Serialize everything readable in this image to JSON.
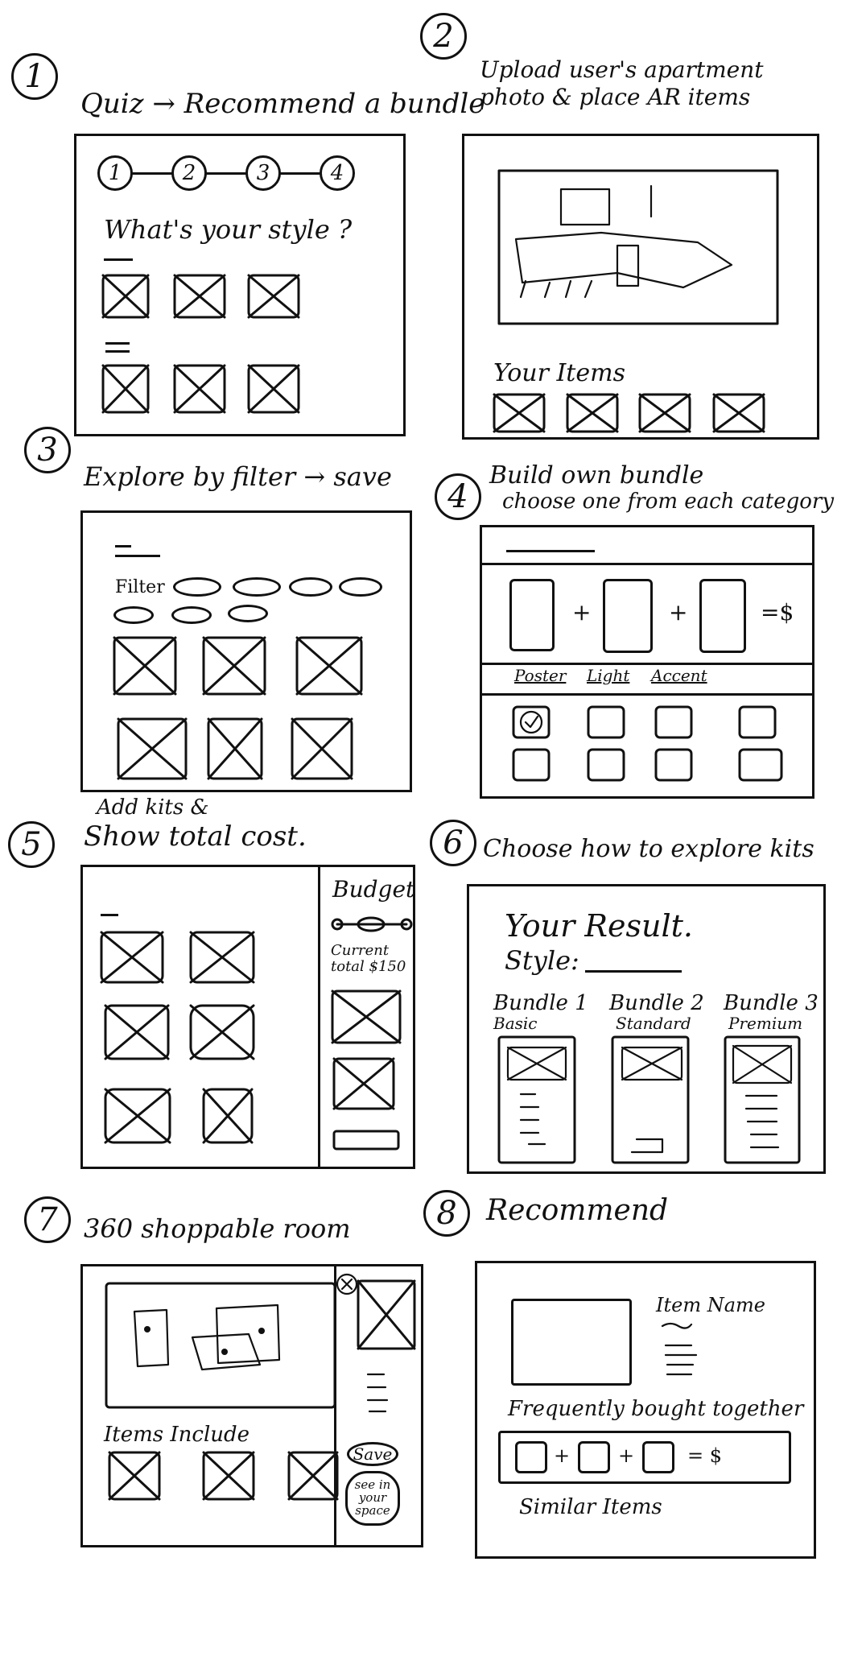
{
  "panels": [
    {
      "number": "1",
      "title": "Quiz → Recommend a bundle",
      "steps": [
        "1",
        "2",
        "3",
        "4"
      ],
      "question": "What's your style ?"
    },
    {
      "number": "2",
      "title": "Upload user's apartment photo & place AR items",
      "items_label": "Your Items"
    },
    {
      "number": "3",
      "title": "Explore by filter → save",
      "filter_label": "Filter"
    },
    {
      "number": "4",
      "title": "Build own bundle",
      "subtitle": "choose one from each category",
      "plus": "+",
      "equals": "=$",
      "tabs": [
        "Poster",
        "Light",
        "Accent"
      ]
    },
    {
      "number": "5",
      "title": "Add kits &",
      "subtitle": "Show total cost.",
      "budget_label": "Budget",
      "current_total": "Current total $150"
    },
    {
      "number": "6",
      "title": "Choose how to explore kits",
      "result_label": "Your Result.",
      "style_label": "Style:",
      "bundles": [
        {
          "name": "Bundle 1",
          "tier": "Basic"
        },
        {
          "name": "Bundle 2",
          "tier": "Standard"
        },
        {
          "name": "Bundle 3",
          "tier": "Premium"
        }
      ]
    },
    {
      "number": "7",
      "title": "360 shoppable room",
      "items_include": "Items Include",
      "save_label": "Save",
      "see_in_space": "see in your space"
    },
    {
      "number": "8",
      "title": "Recommend",
      "item_name": "Item Name",
      "frequently_bought": "Frequently bought together",
      "equals": "= $",
      "similar_items": "Similar Items"
    }
  ]
}
